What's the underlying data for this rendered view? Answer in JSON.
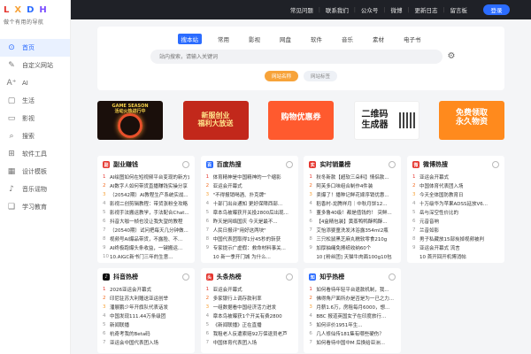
{
  "logo": {
    "letters": [
      "L",
      "X",
      "D",
      "H"
    ],
    "tagline": "做个有用的导航"
  },
  "sidebar": {
    "items": [
      {
        "label": "首页",
        "icon": "compass-icon",
        "glyph": "⊙",
        "active": true
      },
      {
        "label": "自定义网站",
        "icon": "edit-icon",
        "glyph": "✎"
      },
      {
        "label": "AI",
        "icon": "ai-icon",
        "glyph": "A⁺"
      },
      {
        "label": "生活",
        "icon": "bag-icon",
        "glyph": "▢"
      },
      {
        "label": "影视",
        "icon": "film-icon",
        "glyph": "▭"
      },
      {
        "label": "搜索",
        "icon": "search-icon",
        "glyph": "⌕"
      },
      {
        "label": "软件工具",
        "icon": "grid-icon",
        "glyph": "⊞"
      },
      {
        "label": "设计模板",
        "icon": "layout-icon",
        "glyph": "▦"
      },
      {
        "label": "音乐谣物",
        "icon": "music-icon",
        "glyph": "♪"
      },
      {
        "label": "学习教育",
        "icon": "book-icon",
        "glyph": "❑"
      }
    ]
  },
  "topbar": {
    "links": [
      "常见问题",
      "联系我们",
      "公众号",
      "微博",
      "更新日志",
      "留言板"
    ],
    "login_label": "登录"
  },
  "search": {
    "tabs": [
      "搜本站",
      "常用",
      "影视",
      "网盘",
      "软件",
      "音乐",
      "素材",
      "电子书"
    ],
    "placeholder": "站内搜索，请输入关键词",
    "engines": [
      "网站名称",
      "网站标签"
    ]
  },
  "banners": [
    {
      "text": "GAME SEASON\n活动火热进行中"
    },
    {
      "text": "新服创业\n福利大放送"
    },
    {
      "text": "购物优惠券"
    },
    {
      "text": "二维码\n生成器"
    },
    {
      "text": "免费领取\n永久物资"
    }
  ],
  "hot_lists": [
    {
      "title": "副业赚钱",
      "logo_color": "#e5362f",
      "logo_glyph": "副",
      "items": [
        "AI绘图如何在短视频平台变现的新方式",
        "AI数字人如何带货直播赚钱实操分享",
        "（20542期）AI教程生产系统实战...",
        "影视二创剪辑教程：带货涨粉全攻略",
        "影视手法搬运教学，手法配合Chat...",
        "抖音大咖一帧也没让我失望的教程",
        "（20540期）试问把每天几分钟做...",
        "视频号AI爆品带货，不露脸、不...",
        "AI终极跑爆头条收益，一键搬运...",
        "10.AIGC新书门三年的生意..."
      ]
    },
    {
      "title": "百度热搜",
      "logo_color": "#2b6cff",
      "logo_glyph": "百",
      "items": [
        "体育精神是中国精神的一个缩影",
        "亚运会开幕式",
        "\"不得报销喝酒、扑克牌\"",
        "十部门出台通知 更好保障西部...",
        "章本鸟被曝获开关投2800后出现...",
        "昨天是网络国庆 今天是最不...",
        "人民日报评\"用好这两块\"",
        "中国代表团取得1分45秒的斩获",
        "专家提示广虚假：救命材料事关...",
        "10 新一季开门城 为什么..."
      ]
    },
    {
      "title": "实时销量榜",
      "logo_color": "#e5362f",
      "logo_glyph": "实",
      "items": [
        "秋冬新款【超软三朵料】情侣款...",
        "阿芙多口味组合制作4件装",
        "卖爆了！播种记鲜花嫁序销优惠...",
        "稻香村-龙腾祥月｜中秋月饼12...",
        "董多鲁40级！都是值钱的！ 突鲜...",
        "【4盒精包装】黄蒸鸭鸭酥鸭酥...",
        "艾怡添婴童洗发沐浴露354ml2瓶",
        "三只松鼠黑芝麻丸糯软零食210g",
        "加厚抽绳免擦纸收纳60个",
        "10 [粉丝团] 天猫牛肉面100g10包"
      ]
    },
    {
      "title": "微博热搜",
      "logo_color": "#e5362f",
      "logo_glyph": "微",
      "items": [
        "亚运会开幕式",
        "中国体育代表团入场",
        "今天全体国防教育日",
        "十万级华为苹果ADSS延放V6...",
        "岳与深空性价比的",
        "元音音响",
        "兰音如影",
        "男子私藏放15部炭掉视频被判",
        "亚运会开幕式 流言",
        "10 首开回开机博消帖"
      ]
    },
    {
      "title": "抖音热榜",
      "logo_color": "#111111",
      "logo_glyph": "♪",
      "items": [
        "2026亚运会开幕式",
        "印尼驻苏大利赠送亚运创举",
        "潘展鹏少年开旗队代表话发",
        "中国发现111.44万条级团",
        "新闻联播",
        "杭奇考我的Beta码",
        "亚运会中国代表团入场"
      ]
    },
    {
      "title": "头条热榜",
      "logo_color": "#e5362f",
      "logo_glyph": "头",
      "items": [
        "亚运会开幕式",
        "多家银行上调存款利率",
        "一组数据看中国经济活力迸发",
        "章本鸟被曝获1个开关有费2800",
        "《新闻联播》正在直播",
        "我租老人反遭索赔92万保退员老芦",
        "中国体育代表团入场"
      ]
    },
    {
      "title": "知乎热榜",
      "logo_color": "#2b6cff",
      "logo_glyph": "知",
      "items": [
        "如何看待年轻平台退款机制，我...",
        "佛得角尸面所办是否是为一已之力...",
        "月薪1.6万，房租每月6000，想...",
        "BBC 报道英国女子在印度旅行...",
        "如何评价1951年生...",
        "几人修仙传181集有哪些硬伤？",
        "如何看待中国中M 后换给亚洲..."
      ]
    }
  ]
}
